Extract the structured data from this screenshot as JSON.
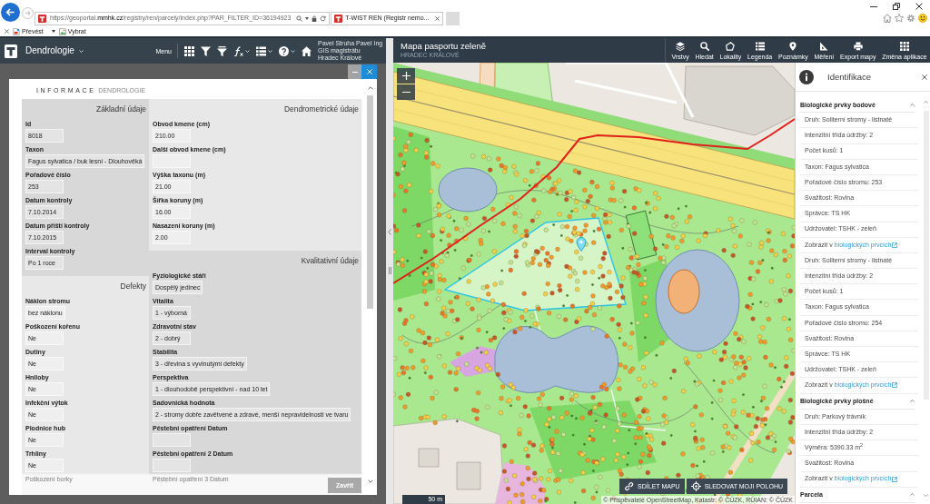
{
  "browser": {
    "url": "https://geoportal.**mmhk.cz**/registry/ren/parcely/index.php?PAR_FILTER_ID=36194923",
    "tabs": [
      {
        "title": "T-WIST REN (Registr nemo...",
        "selected": true
      }
    ],
    "commands": [
      {
        "label": "Převést",
        "has_menu": true
      },
      {
        "label": "Vybrat",
        "has_menu": false
      }
    ]
  },
  "left_app": {
    "title": "Dendrologie",
    "menu_label": "Menu",
    "toolbar": [
      {
        "kind": "grid",
        "has_menu": false
      },
      {
        "kind": "filter",
        "has_menu": false
      },
      {
        "kind": "filter-edit",
        "has_menu": false
      },
      {
        "kind": "function",
        "has_menu": true
      },
      {
        "kind": "list",
        "has_menu": true
      },
      {
        "kind": "help",
        "has_menu": true
      },
      {
        "kind": "home",
        "has_menu": false
      }
    ],
    "user_lines": [
      "Pavel Struha Pavel Ing",
      "GIS magistrátu",
      "Hradec Králové"
    ]
  },
  "dialog": {
    "heading": "INFORMACE",
    "subheading": "DENDROLOGIE",
    "columns": [
      {
        "sections": [
          {
            "title": "Základní údaje",
            "fields": [
              {
                "label": "Id",
                "value": "8018",
                "faded": false
              },
              {
                "label": "Taxon",
                "value": "Fagus sylvatica / buk lesní - Dlouhověká",
                "faded": false
              },
              {
                "label": "Pořadové číslo",
                "value": "253",
                "faded": false
              },
              {
                "label": "Datum kontroly",
                "value": "7.10.2014",
                "faded": false
              },
              {
                "label": "Datum příští kontroly",
                "value": "7.10.2015",
                "faded": false
              },
              {
                "label": "Interval kontroly",
                "value": "Po 1 roce",
                "faded": false
              }
            ]
          },
          {
            "title": "Defekty",
            "fields": [
              {
                "label": "Náklon stromu",
                "value": "bez náklonu",
                "faded": false
              },
              {
                "label": "Poškození kořenu",
                "value": "Ne",
                "faded": false
              },
              {
                "label": "Dutiny",
                "value": "Ne",
                "faded": false
              },
              {
                "label": "Hniloby",
                "value": "Ne",
                "faded": false
              },
              {
                "label": "Infekční výtok",
                "value": "Ne",
                "faded": false
              },
              {
                "label": "Plodnice hub",
                "value": "Ne",
                "faded": false
              },
              {
                "label": "Trhliny",
                "value": "Ne",
                "faded": false
              },
              {
                "label": "Poškození borky",
                "faded": true
              }
            ]
          }
        ]
      },
      {
        "sections": [
          {
            "title": "Dendrometrické údaje",
            "fields": [
              {
                "label": "Obvod kmene (cm)",
                "value": "210.00",
                "faded": false
              },
              {
                "label": "Další obvod kmene (cm)",
                "faded": false
              },
              {
                "label": "Výška taxonu (m)",
                "value": "21.00",
                "faded": false
              },
              {
                "label": "Šířka koruny (m)",
                "value": "16.00",
                "faded": false
              },
              {
                "label": "Nasazení koruny (m)",
                "value": "2.00",
                "faded": false
              }
            ]
          },
          {
            "title": "Kvalitativní údaje",
            "fields": [
              {
                "label": "Fyziologické stáří",
                "value": "Dospělý jedinec",
                "faded": false
              },
              {
                "label": "Vitalita",
                "value": "1 - výborná",
                "faded": false
              },
              {
                "label": "Zdravotní stav",
                "value": "2 - dobrý",
                "faded": false
              },
              {
                "label": "Stabilita",
                "value": "3 - dřevina s vyvinutými defekty",
                "faded": false
              },
              {
                "label": "Perspektiva",
                "value": "1 - dlouhodobě perspektivní - nad 10 let",
                "faded": false
              },
              {
                "label": "Sadovnická hodnota",
                "value": "2 - stromy dobře zavětvené a zdravé, menší nepravidelnosti ve tvaru",
                "faded": false
              },
              {
                "label": "Pěstební opatření Datum",
                "faded": false
              },
              {
                "label": "Pěstební opatření 2 Datum",
                "faded": false
              },
              {
                "label": "Pěstební opatření 3 Datum",
                "faded": true
              }
            ]
          }
        ]
      }
    ],
    "close_label": "Zavřít"
  },
  "map_app": {
    "title": "Mapa pasportu zeleně",
    "subtitle": "HRADEC KRÁLOVÉ",
    "tools": [
      {
        "kind": "layers",
        "label": "Vrstvy"
      },
      {
        "kind": "search",
        "label": "Hledat"
      },
      {
        "kind": "localities",
        "label": "Lokality"
      },
      {
        "kind": "legend",
        "label": "Legenda"
      },
      {
        "kind": "notes",
        "label": "Poznámky"
      },
      {
        "kind": "measure",
        "label": "Měření"
      },
      {
        "kind": "print",
        "label": "Export mapy"
      },
      {
        "kind": "apps",
        "label": "Změna aplikace"
      }
    ],
    "scale": "50 m",
    "actions": [
      {
        "kind": "share",
        "label": "SDÍLET MAPU"
      },
      {
        "kind": "locate",
        "label": "SLEDOVAT MOJI POLOHU"
      }
    ],
    "attribution": "© Přispěvatelé OpenStreetMap, Katastr: © ČÚZK, RÚIAN: © ČÚZK"
  },
  "identification": {
    "title": "Identifikace",
    "sections": [
      {
        "title": "Biologické prvky bodové",
        "expanded": true,
        "records": [
          {
            "rows": [
              "Druh: Soliterní stromy - listnaté",
              "Intenzitní třída údržby: 2",
              "Počet kusů: 1",
              "Taxon: Fagus sylvatica",
              "Pořadové číslo stromu: 253",
              "Svažitost: Rovina",
              "Správce: TS HK",
              "Udržovatel: TSHK - zeleň"
            ],
            "link_intro": "Zobrazit v",
            "link": "biologických prvcích"
          },
          {
            "rows": [
              "Druh: Soliterní stromy - listnaté",
              "Intenzitní třída údržby: 2",
              "Počet kusů: 1",
              "Taxon: Fagus sylvatica",
              "Pořadové číslo stromu: 254",
              "Svažitost: Rovina",
              "Správce: TS HK",
              "Udržovatel: TSHK - zeleň"
            ],
            "link_intro": "Zobrazit v",
            "link": "biologických prvcích"
          }
        ]
      },
      {
        "title": "Biologické prvky plošné",
        "expanded": true,
        "records": [
          {
            "rows": [
              "Druh: Parkový trávník",
              "Intenzitní třída údržby: 2",
              "Výměra: 5390.33 m$^{2}$",
              "Svažitost: Rovina"
            ],
            "link_intro": "Zobrazit v",
            "link": "biologických prvcích"
          }
        ]
      },
      {
        "title": "Parcela",
        "expanded": true
      }
    ]
  }
}
